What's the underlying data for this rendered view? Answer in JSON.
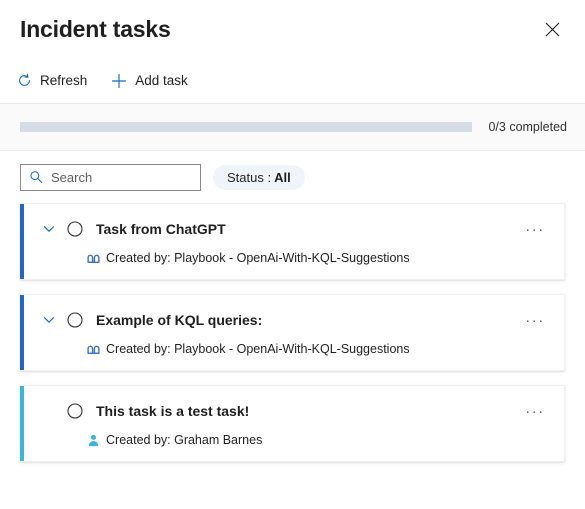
{
  "header": {
    "title": "Incident tasks",
    "close_icon": "close-icon"
  },
  "toolbar": {
    "refresh_label": "Refresh",
    "refresh_icon": "refresh-icon",
    "add_task_label": "Add task",
    "add_task_icon": "plus-icon"
  },
  "progress": {
    "completed": 0,
    "total": 3,
    "percent": 0,
    "label": "0/3 completed"
  },
  "filters": {
    "search_placeholder": "Search",
    "search_value": "",
    "search_icon": "search-icon",
    "status_label": "Status :",
    "status_value": "All"
  },
  "colors": {
    "accent_blue": "#2266cc",
    "accent_teal": "#3ab7d6",
    "link_blue": "#0f6cbd",
    "progress_track": "#d6dce6",
    "pill_bg": "#eff4fb",
    "strip_bg": "#fafafa"
  },
  "tasks": [
    {
      "title": "Task from ChatGPT",
      "creator_prefix": "Created by:",
      "creator": "Playbook - OpenAi-With-KQL-Suggestions",
      "meta_text": "Created by: Playbook - OpenAi-With-KQL-Suggestions",
      "source_icon": "playbook-icon",
      "accent": "#2266cc",
      "expandable": true,
      "completed": false,
      "more_label": "···"
    },
    {
      "title": "Example of KQL queries:",
      "creator_prefix": "Created by:",
      "creator": "Playbook - OpenAi-With-KQL-Suggestions",
      "meta_text": "Created by: Playbook - OpenAi-With-KQL-Suggestions",
      "source_icon": "playbook-icon",
      "accent": "#2266cc",
      "expandable": true,
      "completed": false,
      "more_label": "···"
    },
    {
      "title": "This task is a test task!",
      "creator_prefix": "Created by:",
      "creator": "Graham Barnes",
      "meta_text": "Created by: Graham Barnes",
      "source_icon": "user-icon",
      "accent": "#3ab7d6",
      "expandable": false,
      "completed": false,
      "more_label": "···"
    }
  ]
}
